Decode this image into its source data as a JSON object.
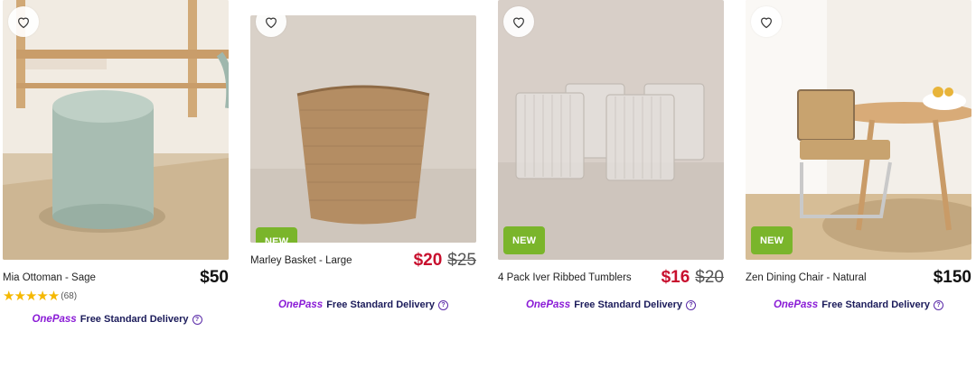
{
  "products": [
    {
      "name": "Mia Ottoman - Sage",
      "price": "$50",
      "rating_value": 5,
      "reviews": "(68)",
      "badge": "",
      "icon": "heart-outline"
    },
    {
      "name": "Marley Basket - Large",
      "price": "$20",
      "was_price": "$25",
      "badge": "NEW",
      "icon": "heart-outline"
    },
    {
      "name": "4 Pack Iver Ribbed Tumblers",
      "price": "$16",
      "was_price": "$20",
      "badge": "NEW",
      "icon": "heart-outline"
    },
    {
      "name": "Zen Dining Chair - Natural",
      "price": "$150",
      "badge": "NEW",
      "icon": "heart-outline"
    }
  ],
  "delivery": {
    "brand": "OnePass",
    "text": "Free Standard Delivery",
    "help_icon": "question-circle-icon"
  },
  "colors": {
    "sale": "#c8102e",
    "badge": "#7ab52b",
    "onepass": "#8a1bd6",
    "stars": "#f5b800"
  }
}
